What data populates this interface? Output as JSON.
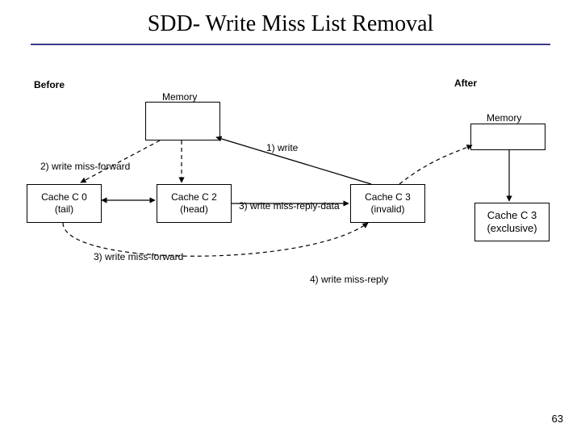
{
  "title": "SDD- Write Miss List Removal",
  "labels": {
    "before": "Before",
    "after": "After",
    "memory_before": "Memory",
    "memory_after": "Memory",
    "step1": "1) write",
    "step2": "2) write miss-forward",
    "step3_data": "3) write miss-reply-data",
    "step3_fwd": "3) write miss-forward",
    "step4": "4) write miss-reply",
    "c0": "Cache C 0",
    "c0_role": "(tail)",
    "c2": "Cache C 2",
    "c2_role": "(head)",
    "c3": "Cache C 3",
    "c3_role": "(invalid)",
    "c3_after": "Cache C 3",
    "c3_after_role": "(exclusive)"
  },
  "slide_number": "63"
}
